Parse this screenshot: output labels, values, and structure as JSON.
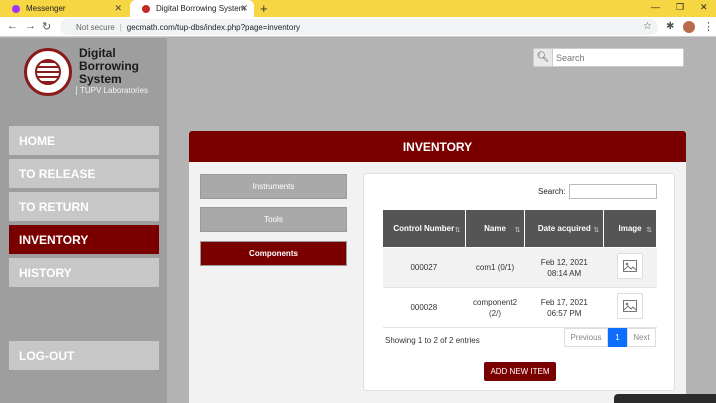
{
  "browser": {
    "tabs": [
      {
        "label": "Messenger",
        "favicon_color": "#a033ff"
      },
      {
        "label": "Digital Borrowing System",
        "favicon_color": "#c62828"
      }
    ],
    "address": {
      "secure_label": "Not secure",
      "url": "gecmath.com/tup-dbs/index.php?page=inventory"
    }
  },
  "sidebar": {
    "brand": {
      "line1": "Digital",
      "line2": "Borrowing",
      "line3": "System",
      "subtitle": "TUPV Laboratories"
    },
    "nav": [
      {
        "label": "HOME",
        "active": false
      },
      {
        "label": "TO RELEASE",
        "active": false
      },
      {
        "label": "TO RETURN",
        "active": false
      },
      {
        "label": "INVENTORY",
        "active": true
      },
      {
        "label": "HISTORY",
        "active": false
      }
    ],
    "logout": "LOG-OUT"
  },
  "top_search": {
    "placeholder": "Search"
  },
  "panel": {
    "title": "INVENTORY",
    "categories": [
      {
        "label": "Instruments",
        "active": false
      },
      {
        "label": "Tools",
        "active": false
      },
      {
        "label": "Components",
        "active": true
      }
    ],
    "table_search_label": "Search:",
    "columns": [
      "Control Number",
      "Name",
      "Date acquired",
      "Image"
    ],
    "rows": [
      {
        "control": "000027",
        "name_line1": "com1 (0/1)",
        "name_line2": "",
        "date_line1": "Feb 12, 2021",
        "date_line2": "08:14 AM"
      },
      {
        "control": "000028",
        "name_line1": "component2",
        "name_line2": "(2/)",
        "date_line1": "Feb 17, 2021",
        "date_line2": "06:57 PM"
      }
    ],
    "info": "Showing 1 to 2 of 2 entries",
    "pager": {
      "prev": "Previous",
      "current": "1",
      "next": "Next"
    },
    "add_button": "ADD NEW ITEM"
  },
  "colors": {
    "accent": "#7a0000",
    "page_link_active": "#0d6efd",
    "tabbar": "#f6d642"
  }
}
